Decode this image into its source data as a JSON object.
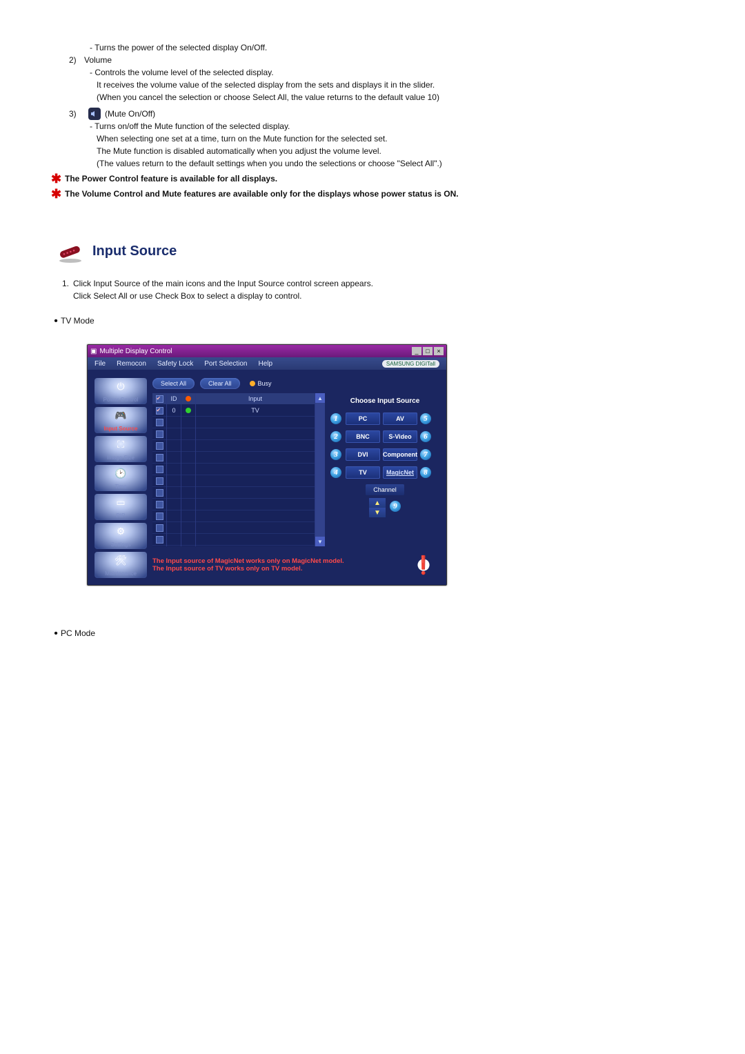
{
  "intro": {
    "power_desc": "- Turns the power of the selected display On/Off.",
    "volume_num": "2)",
    "volume_label": "Volume",
    "volume_l1": "- Controls the volume level of the selected display.",
    "volume_l2": "It receives the volume value of the selected display from the sets and displays it in the slider.",
    "volume_l3": "(When you cancel the selection or choose Select All, the value returns to the default value 10)",
    "mute_num": "3)",
    "mute_label": "(Mute On/Off)",
    "mute_l1": "- Turns on/off the Mute function of the selected display.",
    "mute_l2": "When selecting one set at a time, turn on the Mute function for the selected set.",
    "mute_l3": "The Mute function is disabled automatically when you adjust the volume level.",
    "mute_l4": "(The values return to the default settings when you undo the selections or choose \"Select All\".)",
    "note1": "The Power Control feature is available for all displays.",
    "note2": "The Volume Control and Mute features are available only for the displays whose power status is ON."
  },
  "section": {
    "title": "Input Source",
    "step1_num": "1.",
    "step1_a": "Click Input Source of the main icons and the Input Source control screen appears.",
    "step1_b": "Click Select All or use Check Box to select a display to control.",
    "tv_mode": "TV Mode",
    "pc_mode": "PC Mode"
  },
  "mdc": {
    "window_title": "Multiple Display Control",
    "menu": {
      "file": "File",
      "remocon": "Remocon",
      "safety": "Safety Lock",
      "port": "Port Selection",
      "help": "Help"
    },
    "brand": "SAMSUNG DIGITall",
    "btn_select_all": "Select All",
    "btn_clear_all": "Clear All",
    "busy": "Busy",
    "side": {
      "power": "Power Control",
      "input": "Input Source",
      "image": "Image Size",
      "time": "Time",
      "pip": "PIP",
      "settings": "Settings",
      "maint": "Maintenance"
    },
    "grid": {
      "hdr_id": "ID",
      "hdr_input": "Input",
      "row0_id": "0",
      "row0_input": "TV"
    },
    "choose": {
      "title": "Choose Input Source",
      "pc": "PC",
      "bnc": "BNC",
      "dvi": "DVI",
      "tv": "TV",
      "av": "AV",
      "svideo": "S-Video",
      "component": "Component",
      "magicnet": "MagicNet",
      "channel": "Channel"
    },
    "numbers": {
      "n1": "1",
      "n2": "2",
      "n3": "3",
      "n4": "4",
      "n5": "5",
      "n6": "6",
      "n7": "7",
      "n8": "8",
      "n9": "9"
    },
    "footer_l1": "The Input source of MagicNet works only on MagicNet model.",
    "footer_l2": "The Input source of TV works only on TV  model."
  }
}
